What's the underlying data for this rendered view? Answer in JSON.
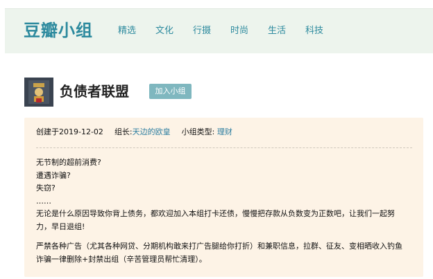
{
  "header": {
    "logo": "豆瓣小组",
    "nav": [
      "精选",
      "文化",
      "行摄",
      "时尚",
      "生活",
      "科技"
    ]
  },
  "group": {
    "title": "负债者联盟",
    "join_label": "加入小组",
    "created": "创建于2019-12-02",
    "owner_label": "组长:",
    "owner_name": "天边的欧皇",
    "type_label": "小组类型:",
    "type_value": "理财"
  },
  "description": {
    "lines": [
      "无节制的超前消费?",
      "遭遇诈骗?",
      "失窃?",
      "……",
      "无论是什么原因导致你背上债务，都欢迎加入本组打卡还债，慢慢把存款从负数变为正数吧，让我们一起努",
      "力，早日退组!",
      "严禁各种广告（尤其各种网贷、分期机构敢来打广告腿给你打折）和兼职信息，拉群、征友、变相晒收入钓鱼",
      "诈骗一律删除+封禁出组（辛苦管理员帮忙清理）。"
    ]
  },
  "colors": {
    "brand": "#2d8a9e",
    "header_bg": "#edf4ed",
    "info_bg": "#fdf3e6",
    "join_button": "#7fb7bf"
  }
}
